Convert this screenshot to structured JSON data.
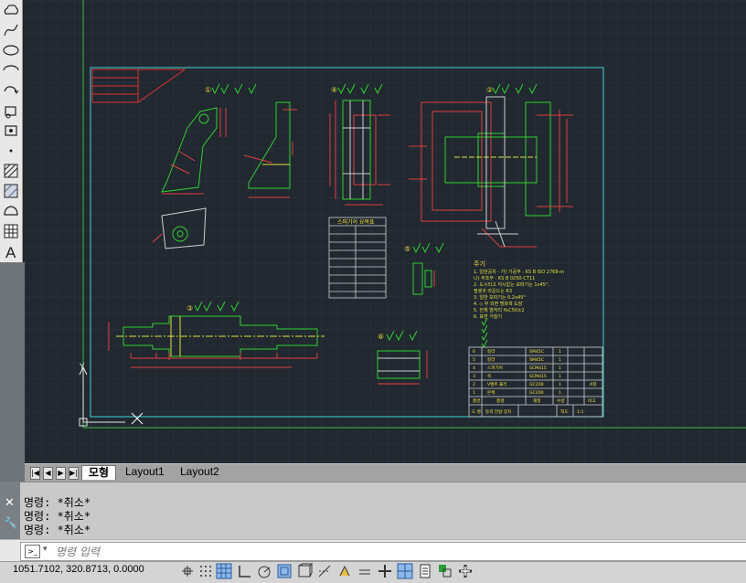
{
  "layout_tabs": [
    "모형",
    "Layout1",
    "Layout2"
  ],
  "command_history": [
    "명령: *취소*",
    "명령: *취소*",
    "명령: *취소*"
  ],
  "command_input": {
    "placeholder": "명령 입력"
  },
  "status": {
    "coordinates": "1051.7102, 320.8713, 0.0000"
  },
  "toolbar_tools": [
    "revcloud-icon",
    "spline-icon",
    "ellipse-icon",
    "ellipse-arc-icon",
    "insert-block-icon",
    "make-block-icon",
    "point-icon",
    "hatch-icon",
    "gradient-icon",
    "region-icon",
    "table-icon",
    "mtext-icon",
    "add-selected-icon"
  ],
  "status_toggles": [
    "infer-constraints-icon",
    "snap-icon",
    "grid-icon",
    "ortho-icon",
    "polar-icon",
    "osnap-icon",
    "3d-osnap-icon",
    "otrack-icon",
    "ducs-icon",
    "dyn-icon",
    "lineweight-icon",
    "transparency-icon",
    "quick-properties-icon",
    "selection-cycling-icon",
    "annotation-monitor-icon"
  ],
  "drawing": {
    "bom_header": [
      "품번",
      "품명",
      "재질",
      "수량",
      "비고"
    ],
    "bom_rows": [
      [
        "6",
        "칼라",
        "SM45C",
        "1",
        ""
      ],
      [
        "5",
        "칼라",
        "SM45C",
        "1",
        ""
      ],
      [
        "4",
        "스퍼기어",
        "SCM415",
        "1",
        ""
      ],
      [
        "3",
        "축",
        "SCM415",
        "1",
        ""
      ],
      [
        "2",
        "V벨트 풀리",
        "GC200",
        "1",
        "A형"
      ],
      [
        "1",
        "본체",
        "GC200",
        "1",
        ""
      ]
    ],
    "title_block": [
      "도 명",
      "동력 전달 장치",
      "척도",
      "1:1"
    ],
    "spur_gear_table_title": "스퍼기어 요목표",
    "spur_gear_rows": [
      [
        "기어치형",
        "표준"
      ],
      [
        "공구 치형",
        "보통이"
      ],
      [
        "모듈",
        "2"
      ],
      [
        "압력각",
        "20°"
      ],
      [
        "잇수",
        "34"
      ],
      [
        "피치원지름",
        "Ø68"
      ],
      [
        "전체 이 높이",
        "4.5"
      ],
      [
        "다듬질 방법",
        "호브 절삭"
      ],
      [
        "정밀도",
        "KS B ISO 1328-1, 5급"
      ]
    ],
    "notes_title": "주기",
    "notes": [
      "1. 일반공차 - 가) 가공부 : KS B ISO 2768-m",
      "   나) 주조부 : KS B 0250-CT11",
      "2. 도시되고 지시없는 모따기는 1x45°,",
      "   필렛과 라운드는 R3",
      "3. 일반 모따기는 0.2x45°",
      "4. ◇ 부 외면 명회색 도장",
      "5. 전체 열처리 H₈C50±2",
      "6. 표면 거칠기"
    ],
    "part_labels": [
      "①",
      "②",
      "③",
      "④",
      "⑤",
      "⑥"
    ],
    "sheet_label_1": "Y",
    "sheet_label_2": "X"
  }
}
